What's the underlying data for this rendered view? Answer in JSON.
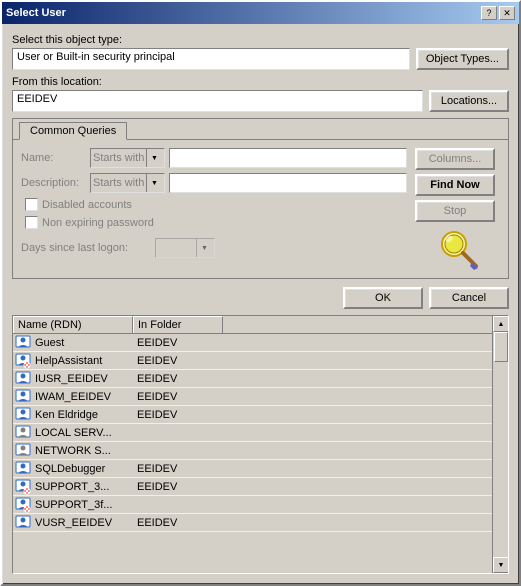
{
  "window": {
    "title": "Select User",
    "title_btn_help": "?",
    "title_btn_close": "✕"
  },
  "object_type": {
    "label": "Select this object type:",
    "value": "User or Built-in security principal",
    "button_label": "Object Types..."
  },
  "location": {
    "label": "From this location:",
    "value": "EEIDEV",
    "button_label": "Locations..."
  },
  "tab": {
    "label": "Common Queries"
  },
  "form": {
    "name_label": "Name:",
    "name_combo": "Starts with",
    "description_label": "Description:",
    "description_combo": "Starts with",
    "disabled_accounts_label": "Disabled accounts",
    "non_expiring_label": "Non expiring password",
    "days_label": "Days since last logon:"
  },
  "buttons": {
    "columns": "Columns...",
    "find_now": "Find Now",
    "stop": "Stop",
    "ok": "OK",
    "cancel": "Cancel"
  },
  "results": {
    "col_name": "Name (RDN)",
    "col_folder": "In Folder",
    "rows": [
      {
        "name": "Guest",
        "folder": "EEIDEV",
        "type": "user"
      },
      {
        "name": "HelpAssistant",
        "folder": "EEIDEV",
        "type": "user-disabled"
      },
      {
        "name": "IUSR_EEIDEV",
        "folder": "EEIDEV",
        "type": "user"
      },
      {
        "name": "IWAM_EEIDEV",
        "folder": "EEIDEV",
        "type": "user"
      },
      {
        "name": "Ken Eldridge",
        "folder": "EEIDEV",
        "type": "user"
      },
      {
        "name": "LOCAL SERV...",
        "folder": "",
        "type": "user-special"
      },
      {
        "name": "NETWORK S...",
        "folder": "",
        "type": "user-special"
      },
      {
        "name": "SQLDebugger",
        "folder": "EEIDEV",
        "type": "user"
      },
      {
        "name": "SUPPORT_3...",
        "folder": "EEIDEV",
        "type": "user-disabled"
      },
      {
        "name": "SUPPORT_3f...",
        "folder": "",
        "type": "user-disabled"
      },
      {
        "name": "VUSR_EEIDEV",
        "folder": "EEIDEV",
        "type": "user"
      }
    ]
  }
}
